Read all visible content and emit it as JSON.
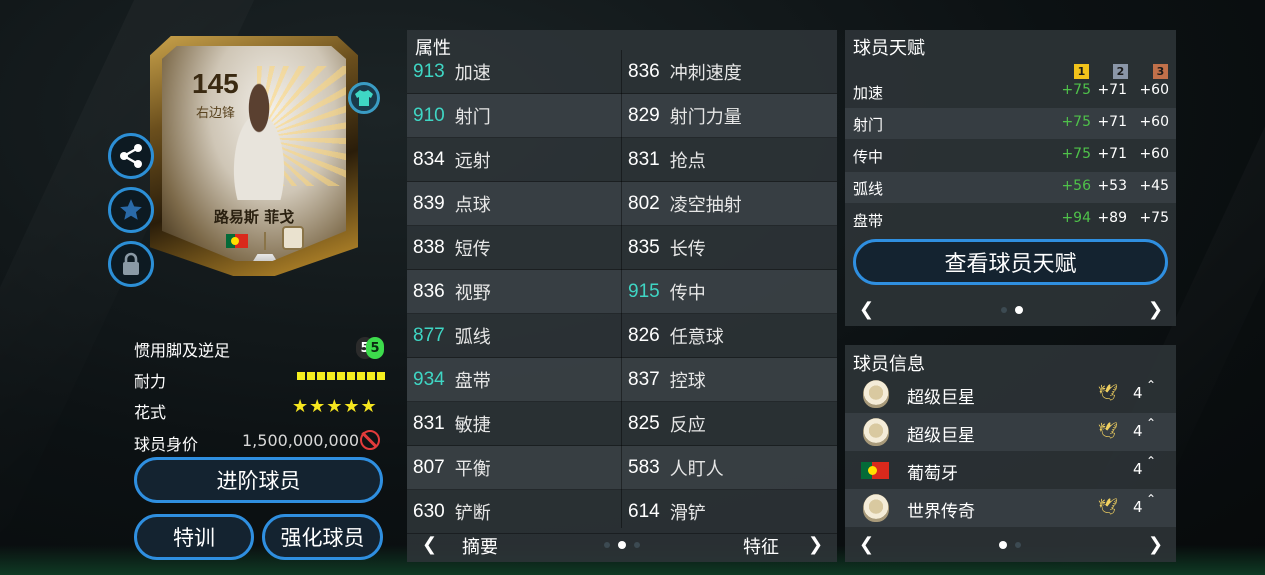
{
  "card": {
    "rating": "145",
    "position": "右边锋",
    "name": "路易斯 菲戈",
    "icons": [
      "share-icon",
      "star-icon",
      "lock-icon",
      "jersey-icon",
      "flag-portugal-icon",
      "icon-club-badge"
    ]
  },
  "info": {
    "foot_label": "惯用脚及逆足",
    "foot_main": "5",
    "foot_weak": "5",
    "stamina_label": "耐力",
    "stamina_level": 1.0,
    "skill_label": "花式",
    "skill_stars": "★★★★★",
    "value_label": "球员身价",
    "value": "1,500,000,000"
  },
  "buttons": {
    "advance": "进阶球员",
    "training": "特训",
    "enhance": "强化球员"
  },
  "attributes": {
    "title": "属性",
    "rows": [
      {
        "lv": "913",
        "ln": "加速",
        "lhi": true,
        "rv": "836",
        "rn": "冲刺速度",
        "rhi": false
      },
      {
        "lv": "910",
        "ln": "射门",
        "lhi": true,
        "rv": "829",
        "rn": "射门力量",
        "rhi": false
      },
      {
        "lv": "834",
        "ln": "远射",
        "lhi": false,
        "rv": "831",
        "rn": "抢点",
        "rhi": false
      },
      {
        "lv": "839",
        "ln": "点球",
        "lhi": false,
        "rv": "802",
        "rn": "凌空抽射",
        "rhi": false
      },
      {
        "lv": "838",
        "ln": "短传",
        "lhi": false,
        "rv": "835",
        "rn": "长传",
        "rhi": false
      },
      {
        "lv": "836",
        "ln": "视野",
        "lhi": false,
        "rv": "915",
        "rn": "传中",
        "rhi": true
      },
      {
        "lv": "877",
        "ln": "弧线",
        "lhi": true,
        "rv": "826",
        "rn": "任意球",
        "rhi": false
      },
      {
        "lv": "934",
        "ln": "盘带",
        "lhi": true,
        "rv": "837",
        "rn": "控球",
        "rhi": false
      },
      {
        "lv": "831",
        "ln": "敏捷",
        "lhi": false,
        "rv": "825",
        "rn": "反应",
        "rhi": false
      },
      {
        "lv": "807",
        "ln": "平衡",
        "lhi": false,
        "rv": "583",
        "rn": "人盯人",
        "rhi": false
      },
      {
        "lv": "630",
        "ln": "铲断",
        "lhi": false,
        "rv": "614",
        "rn": "滑铲",
        "rhi": false
      }
    ],
    "nav_left": "摘要",
    "nav_right": "特征",
    "colors": {
      "highlight": "#3fd6c4"
    }
  },
  "talent": {
    "title": "球员天赋",
    "tiers": [
      "1",
      "2",
      "3"
    ],
    "tier_colors": [
      "#f2c31b",
      "#8a96a8",
      "#c0704a"
    ],
    "rows": [
      {
        "label": "加速",
        "t1": "+75",
        "t2": "+71",
        "t3": "+60"
      },
      {
        "label": "射门",
        "t1": "+75",
        "t2": "+71",
        "t3": "+60"
      },
      {
        "label": "传中",
        "t1": "+75",
        "t2": "+71",
        "t3": "+60"
      },
      {
        "label": "弧线",
        "t1": "+56",
        "t2": "+53",
        "t3": "+45"
      },
      {
        "label": "盘带",
        "t1": "+94",
        "t2": "+89",
        "t3": "+75"
      }
    ],
    "view_button": "查看球员天赋"
  },
  "player_info": {
    "title": "球员信息",
    "rows": [
      {
        "icon": "icon-badge",
        "text": "超级巨星",
        "dove": true,
        "level": "4"
      },
      {
        "icon": "icon-badge",
        "text": "超级巨星",
        "dove": true,
        "level": "4"
      },
      {
        "icon": "flag-portugal",
        "text": "葡萄牙",
        "dove": false,
        "level": "4"
      },
      {
        "icon": "icon-badge",
        "text": "世界传奇",
        "dove": true,
        "level": "4"
      }
    ]
  },
  "glyphs": {
    "arrow_left": "❮",
    "arrow_right": "❯",
    "dove": "🕊",
    "caret": "⌃"
  }
}
